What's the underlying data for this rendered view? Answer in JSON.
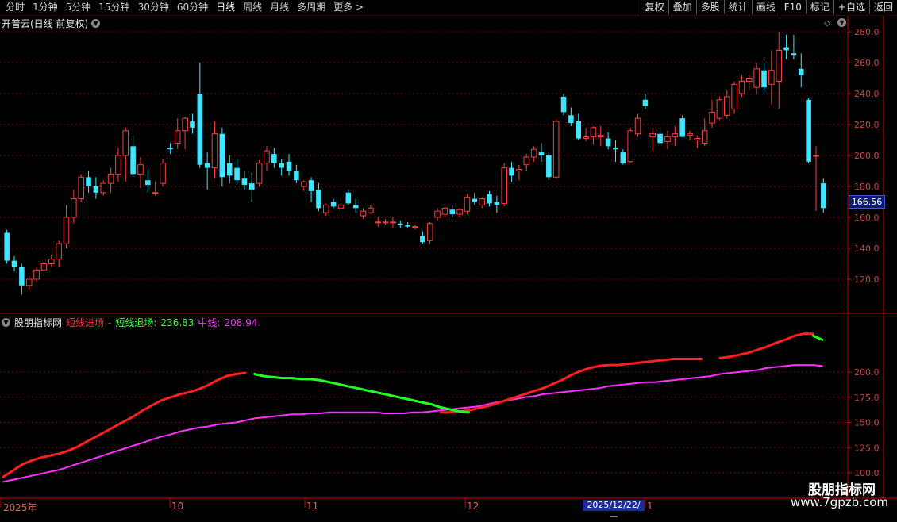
{
  "toolbar": {
    "periods": [
      "分时",
      "1分钟",
      "5分钟",
      "15分钟",
      "30分钟",
      "60分钟",
      "日线",
      "周线",
      "月线",
      "多周期",
      "更多 >"
    ],
    "active_period": "日线",
    "actions": [
      "复权",
      "叠加",
      "多股",
      "统计",
      "画线",
      "F10",
      "标记",
      "+自选",
      "返回"
    ]
  },
  "main_chart": {
    "title": "开普云(日线 前复权)",
    "y_ticks": [
      "280.0",
      "260.0",
      "240.0",
      "220.0",
      "200.0",
      "180.0",
      "160.0",
      "140.0",
      "120.0"
    ],
    "current_price": "166.56"
  },
  "sub_chart": {
    "name": "股朋指标网",
    "line1_label": "短线进场",
    "line1_value": "-",
    "line2_label": "短线退场:",
    "line2_value": "236.83",
    "line3_label": "中线:",
    "line3_value": "208.94",
    "y_ticks": [
      "200.0",
      "175.0",
      "150.0",
      "125.0",
      "100.0"
    ]
  },
  "x_axis": {
    "labels": [
      "2025年",
      "10",
      "11",
      "12",
      "1"
    ],
    "cursor_date": "2025/12/22/—"
  },
  "watermark": {
    "line1": "股朋指标网",
    "line2": "www.7gpzb.com"
  },
  "colors": {
    "up": "#ff3c3c",
    "down": "#40e6ff",
    "grid": "#7a0000",
    "axis": "#c00000",
    "line_enter": "#ff2020",
    "line_exit": "#22ff22",
    "line_mid": "#ff30ff"
  },
  "chart_data": {
    "type": "candlestick",
    "ylim": [
      100,
      290
    ],
    "candles": [
      {
        "o": 150,
        "h": 152,
        "l": 130,
        "c": 132
      },
      {
        "o": 132,
        "h": 135,
        "l": 125,
        "c": 128
      },
      {
        "o": 128,
        "h": 130,
        "l": 110,
        "c": 116
      },
      {
        "o": 116,
        "h": 122,
        "l": 113,
        "c": 120
      },
      {
        "o": 120,
        "h": 128,
        "l": 118,
        "c": 126
      },
      {
        "o": 126,
        "h": 132,
        "l": 122,
        "c": 130
      },
      {
        "o": 130,
        "h": 136,
        "l": 128,
        "c": 133
      },
      {
        "o": 133,
        "h": 145,
        "l": 128,
        "c": 143
      },
      {
        "o": 143,
        "h": 168,
        "l": 140,
        "c": 160
      },
      {
        "o": 160,
        "h": 178,
        "l": 156,
        "c": 172
      },
      {
        "o": 172,
        "h": 188,
        "l": 170,
        "c": 186
      },
      {
        "o": 186,
        "h": 190,
        "l": 176,
        "c": 180
      },
      {
        "o": 180,
        "h": 186,
        "l": 172,
        "c": 176
      },
      {
        "o": 176,
        "h": 184,
        "l": 174,
        "c": 182
      },
      {
        "o": 182,
        "h": 192,
        "l": 176,
        "c": 188
      },
      {
        "o": 188,
        "h": 205,
        "l": 183,
        "c": 200
      },
      {
        "o": 200,
        "h": 218,
        "l": 183,
        "c": 216
      },
      {
        "o": 206,
        "h": 213,
        "l": 186,
        "c": 188
      },
      {
        "o": 188,
        "h": 199,
        "l": 179,
        "c": 194
      },
      {
        "o": 184,
        "h": 191,
        "l": 176,
        "c": 181
      },
      {
        "o": 176,
        "h": 183,
        "l": 174,
        "c": 176
      },
      {
        "o": 182,
        "h": 198,
        "l": 180,
        "c": 195
      },
      {
        "o": 205,
        "h": 208,
        "l": 201,
        "c": 204
      },
      {
        "o": 208,
        "h": 224,
        "l": 204,
        "c": 216
      },
      {
        "o": 216,
        "h": 225,
        "l": 204,
        "c": 224
      },
      {
        "o": 222,
        "h": 227,
        "l": 214,
        "c": 218
      },
      {
        "o": 240,
        "h": 260,
        "l": 192,
        "c": 194
      },
      {
        "o": 195,
        "h": 202,
        "l": 178,
        "c": 192
      },
      {
        "o": 192,
        "h": 222,
        "l": 185,
        "c": 214
      },
      {
        "o": 214,
        "h": 218,
        "l": 180,
        "c": 186
      },
      {
        "o": 195,
        "h": 200,
        "l": 182,
        "c": 187
      },
      {
        "o": 192,
        "h": 198,
        "l": 181,
        "c": 184
      },
      {
        "o": 185,
        "h": 190,
        "l": 178,
        "c": 181
      },
      {
        "o": 182,
        "h": 189,
        "l": 170,
        "c": 178
      },
      {
        "o": 182,
        "h": 197,
        "l": 180,
        "c": 195
      },
      {
        "o": 195,
        "h": 206,
        "l": 190,
        "c": 203
      },
      {
        "o": 201,
        "h": 205,
        "l": 192,
        "c": 195
      },
      {
        "o": 195,
        "h": 198,
        "l": 187,
        "c": 192
      },
      {
        "o": 196,
        "h": 201,
        "l": 187,
        "c": 190
      },
      {
        "o": 190,
        "h": 194,
        "l": 182,
        "c": 184
      },
      {
        "o": 180,
        "h": 184,
        "l": 177,
        "c": 183
      },
      {
        "o": 184,
        "h": 186,
        "l": 170,
        "c": 177
      },
      {
        "o": 178,
        "h": 182,
        "l": 164,
        "c": 166
      },
      {
        "o": 163,
        "h": 169,
        "l": 161,
        "c": 168
      },
      {
        "o": 170,
        "h": 172,
        "l": 166,
        "c": 167
      },
      {
        "o": 166,
        "h": 172,
        "l": 164,
        "c": 168
      },
      {
        "o": 176,
        "h": 178,
        "l": 168,
        "c": 169
      },
      {
        "o": 168,
        "h": 172,
        "l": 163,
        "c": 166
      },
      {
        "o": 161,
        "h": 166,
        "l": 159,
        "c": 164
      },
      {
        "o": 163,
        "h": 168,
        "l": 162,
        "c": 166
      },
      {
        "o": 157,
        "h": 160,
        "l": 154,
        "c": 157
      },
      {
        "o": 157,
        "h": 159,
        "l": 155,
        "c": 157
      },
      {
        "o": 157,
        "h": 160,
        "l": 153,
        "c": 157
      },
      {
        "o": 156,
        "h": 158,
        "l": 153,
        "c": 155
      },
      {
        "o": 155,
        "h": 157,
        "l": 153,
        "c": 154
      },
      {
        "o": 154,
        "h": 155,
        "l": 152,
        "c": 154
      },
      {
        "o": 148,
        "h": 151,
        "l": 143,
        "c": 144
      },
      {
        "o": 145,
        "h": 157,
        "l": 143,
        "c": 156
      },
      {
        "o": 160,
        "h": 166,
        "l": 158,
        "c": 164
      },
      {
        "o": 162,
        "h": 167,
        "l": 160,
        "c": 166
      },
      {
        "o": 165,
        "h": 168,
        "l": 160,
        "c": 162
      },
      {
        "o": 162,
        "h": 166,
        "l": 160,
        "c": 165
      },
      {
        "o": 164,
        "h": 175,
        "l": 162,
        "c": 173
      },
      {
        "o": 172,
        "h": 176,
        "l": 168,
        "c": 170
      },
      {
        "o": 168,
        "h": 173,
        "l": 166,
        "c": 172
      },
      {
        "o": 175,
        "h": 177,
        "l": 167,
        "c": 169
      },
      {
        "o": 170,
        "h": 174,
        "l": 163,
        "c": 168
      },
      {
        "o": 169,
        "h": 195,
        "l": 167,
        "c": 192
      },
      {
        "o": 192,
        "h": 196,
        "l": 183,
        "c": 187
      },
      {
        "o": 190,
        "h": 194,
        "l": 184,
        "c": 191
      },
      {
        "o": 194,
        "h": 201,
        "l": 190,
        "c": 199
      },
      {
        "o": 199,
        "h": 206,
        "l": 196,
        "c": 204
      },
      {
        "o": 202,
        "h": 208,
        "l": 196,
        "c": 200
      },
      {
        "o": 200,
        "h": 202,
        "l": 184,
        "c": 186
      },
      {
        "o": 186,
        "h": 223,
        "l": 185,
        "c": 222
      },
      {
        "o": 238,
        "h": 240,
        "l": 226,
        "c": 228
      },
      {
        "o": 226,
        "h": 231,
        "l": 219,
        "c": 221
      },
      {
        "o": 222,
        "h": 227,
        "l": 210,
        "c": 211
      },
      {
        "o": 211,
        "h": 218,
        "l": 209,
        "c": 212
      },
      {
        "o": 212,
        "h": 219,
        "l": 207,
        "c": 218
      },
      {
        "o": 212,
        "h": 219,
        "l": 206,
        "c": 213
      },
      {
        "o": 211,
        "h": 215,
        "l": 204,
        "c": 206
      },
      {
        "o": 205,
        "h": 210,
        "l": 196,
        "c": 204
      },
      {
        "o": 202,
        "h": 204,
        "l": 194,
        "c": 195
      },
      {
        "o": 196,
        "h": 218,
        "l": 195,
        "c": 216
      },
      {
        "o": 214,
        "h": 227,
        "l": 212,
        "c": 224
      },
      {
        "o": 236,
        "h": 240,
        "l": 230,
        "c": 232
      },
      {
        "o": 212,
        "h": 218,
        "l": 203,
        "c": 214
      },
      {
        "o": 214,
        "h": 218,
        "l": 207,
        "c": 208
      },
      {
        "o": 209,
        "h": 216,
        "l": 204,
        "c": 212
      },
      {
        "o": 212,
        "h": 219,
        "l": 206,
        "c": 214
      },
      {
        "o": 224,
        "h": 226,
        "l": 212,
        "c": 212
      },
      {
        "o": 213,
        "h": 216,
        "l": 210,
        "c": 214
      },
      {
        "o": 210,
        "h": 213,
        "l": 205,
        "c": 211
      },
      {
        "o": 208,
        "h": 224,
        "l": 206,
        "c": 216
      },
      {
        "o": 221,
        "h": 236,
        "l": 218,
        "c": 228
      },
      {
        "o": 224,
        "h": 238,
        "l": 223,
        "c": 236
      },
      {
        "o": 226,
        "h": 242,
        "l": 224,
        "c": 238
      },
      {
        "o": 230,
        "h": 248,
        "l": 227,
        "c": 246
      },
      {
        "o": 240,
        "h": 252,
        "l": 238,
        "c": 248
      },
      {
        "o": 248,
        "h": 252,
        "l": 242,
        "c": 250
      },
      {
        "o": 244,
        "h": 260,
        "l": 240,
        "c": 256
      },
      {
        "o": 255,
        "h": 260,
        "l": 240,
        "c": 244
      },
      {
        "o": 246,
        "h": 268,
        "l": 233,
        "c": 255
      },
      {
        "o": 248,
        "h": 280,
        "l": 230,
        "c": 268
      },
      {
        "o": 270,
        "h": 278,
        "l": 262,
        "c": 268
      },
      {
        "o": 266,
        "h": 278,
        "l": 262,
        "c": 265
      },
      {
        "o": 256,
        "h": 266,
        "l": 244,
        "c": 252
      },
      {
        "o": 236,
        "h": 237,
        "l": 195,
        "c": 196
      },
      {
        "o": 200,
        "h": 206,
        "l": 164,
        "c": 200
      },
      {
        "o": 182,
        "h": 185,
        "l": 163,
        "c": 166
      }
    ],
    "indicator": {
      "ylim": [
        100,
        215
      ],
      "mid_line": [
        91,
        93,
        95,
        97,
        99,
        101,
        103,
        106,
        109,
        112,
        115,
        118,
        121,
        124,
        127,
        130,
        133,
        136,
        138,
        141,
        143,
        145,
        146,
        148,
        149,
        150,
        152,
        154,
        155,
        156,
        157,
        158,
        158,
        159,
        159,
        160,
        160,
        160,
        160,
        160,
        160,
        159,
        159,
        159,
        160,
        160,
        161,
        162,
        163,
        164,
        165,
        166,
        168,
        170,
        172,
        173,
        175,
        176,
        178,
        179,
        180,
        181,
        182,
        183,
        184,
        186,
        187,
        188,
        189,
        190,
        190,
        191,
        192,
        193,
        194,
        195,
        196,
        198,
        199,
        200,
        201,
        202,
        204,
        205,
        206,
        207,
        207,
        207,
        206
      ],
      "enter_line": [
        96,
        102,
        108,
        112,
        115,
        117,
        119,
        122,
        126,
        131,
        136,
        141,
        146,
        151,
        156,
        162,
        167,
        172,
        175,
        178,
        180,
        183,
        187,
        192,
        196,
        198,
        199,
        null,
        null,
        null,
        null,
        null,
        null,
        null,
        null,
        null,
        null,
        null,
        null,
        null,
        null,
        null,
        null,
        null,
        null,
        null,
        null,
        160,
        160,
        161,
        162,
        164,
        166,
        169,
        172,
        175,
        178,
        181,
        184,
        188,
        192,
        197,
        201,
        204,
        206,
        207,
        207,
        208,
        209,
        210,
        211,
        212,
        213,
        213,
        213,
        213,
        null,
        214,
        215,
        217,
        219,
        222,
        225,
        229,
        232,
        236,
        238,
        238,
        null
      ],
      "exit_line": [
        null,
        null,
        null,
        null,
        null,
        null,
        null,
        null,
        null,
        null,
        null,
        null,
        null,
        null,
        null,
        null,
        null,
        null,
        null,
        null,
        null,
        null,
        null,
        null,
        null,
        null,
        null,
        198,
        196,
        195,
        194,
        194,
        193,
        193,
        192,
        190,
        188,
        186,
        184,
        182,
        180,
        178,
        176,
        174,
        172,
        170,
        168,
        165,
        163,
        161,
        160,
        null,
        null,
        null,
        null,
        null,
        null,
        null,
        null,
        null,
        null,
        null,
        null,
        null,
        null,
        null,
        null,
        null,
        null,
        null,
        null,
        null,
        null,
        null,
        null,
        null,
        214,
        null,
        null,
        null,
        null,
        null,
        null,
        null,
        null,
        null,
        null,
        236,
        232
      ]
    }
  }
}
